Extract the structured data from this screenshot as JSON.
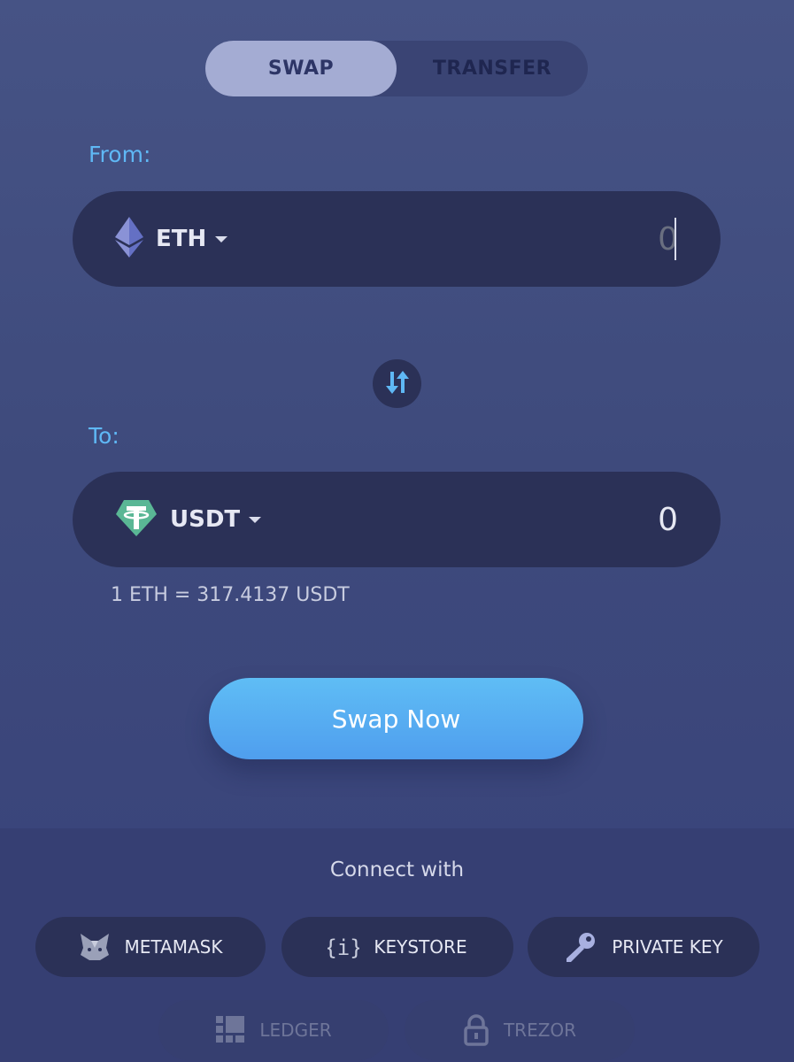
{
  "tabs": {
    "swap": "SWAP",
    "transfer": "TRANSFER",
    "active": "swap"
  },
  "from": {
    "label": "From:",
    "token": "ETH",
    "token_icon": "ethereum-icon",
    "amount_placeholder": "0"
  },
  "to": {
    "label": "To:",
    "token": "USDT",
    "token_icon": "tether-icon",
    "amount": "0"
  },
  "rate": "1 ETH = 317.4137 USDT",
  "swap_button": "Swap Now",
  "connect": {
    "title": "Connect with",
    "wallets": {
      "metamask": "METAMASK",
      "keystore": "KEYSTORE",
      "private_key": "PRIVATE KEY",
      "ledger": "LEDGER",
      "trezor": "TREZOR"
    }
  },
  "colors": {
    "accent_label": "#5fb8f5",
    "button_gradient_top": "#5fbdf5",
    "button_gradient_bottom": "#4f9eee",
    "field_bg": "#2b3157",
    "page_bg": "#465385"
  }
}
